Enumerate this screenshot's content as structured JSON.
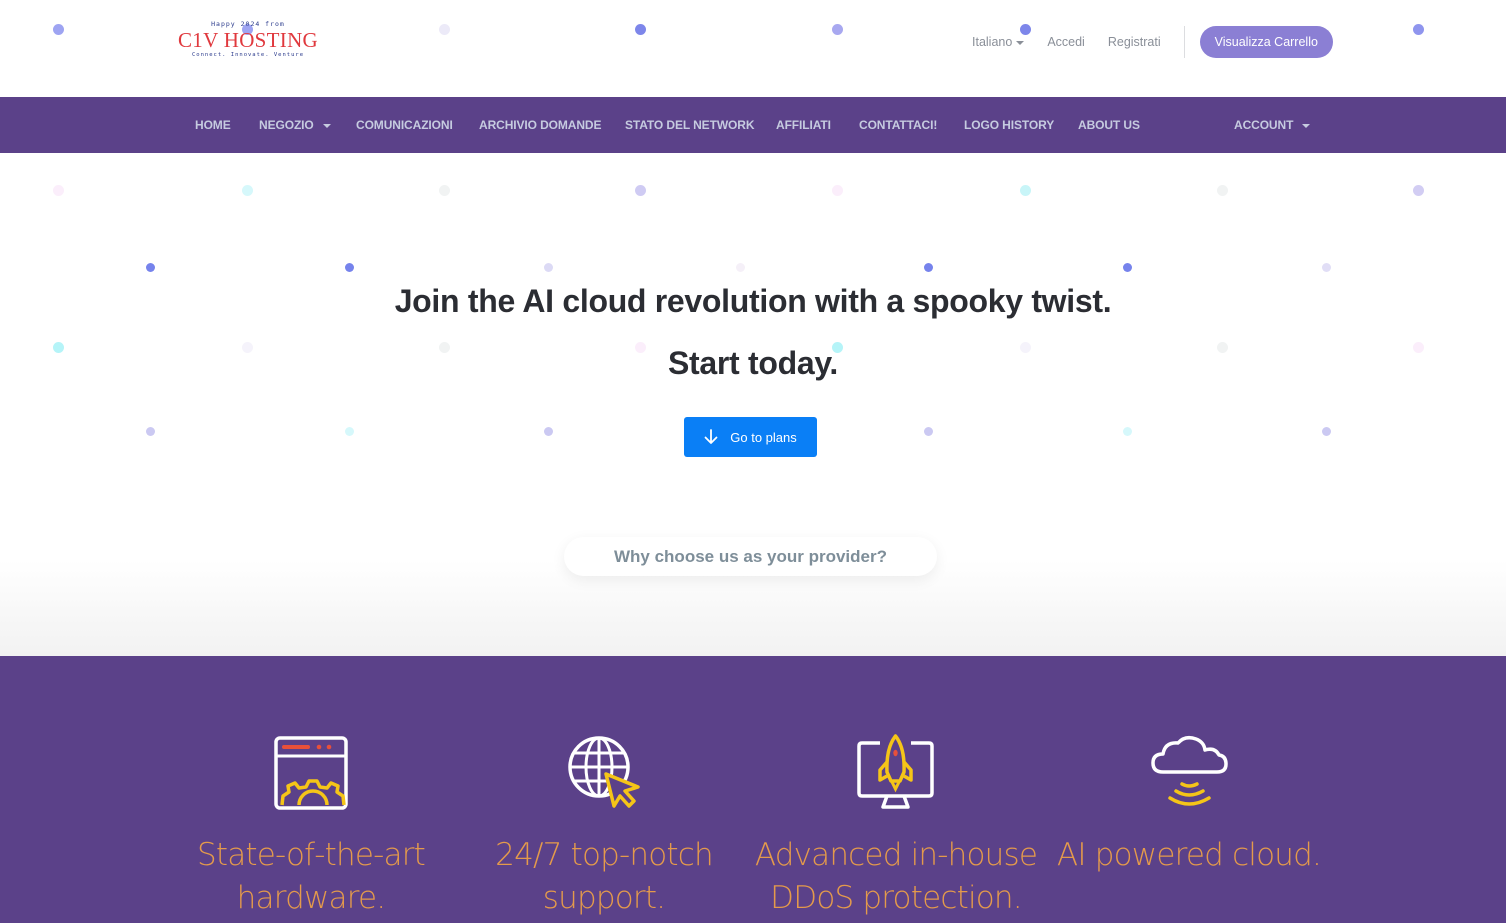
{
  "header": {
    "logo": {
      "tagline_top": "Happy 2024 from",
      "brand": "C1V HOSTING",
      "tagline_bottom": "Connect. Innovate. Venture"
    },
    "language": "Italiano",
    "login": "Accedi",
    "register": "Registrati",
    "cart_button": "Visualizza Carrello"
  },
  "nav": {
    "items": [
      {
        "label": "HOME",
        "dropdown": false
      },
      {
        "label": "NEGOZIO",
        "dropdown": true
      },
      {
        "label": "COMUNICAZIONI",
        "dropdown": false
      },
      {
        "label": "ARCHIVIO DOMANDE",
        "dropdown": false
      },
      {
        "label": "STATO DEL NETWORK",
        "dropdown": false
      },
      {
        "label": "AFFILIATI",
        "dropdown": false
      },
      {
        "label": "CONTATTACI!",
        "dropdown": false
      },
      {
        "label": "LOGO HISTORY",
        "dropdown": false
      },
      {
        "label": "ABOUT US",
        "dropdown": false
      }
    ],
    "account": {
      "label": "ACCOUNT",
      "dropdown": true
    }
  },
  "hero": {
    "title": "Join the AI cloud revolution with a spooky twist.",
    "subtitle": "Start today.",
    "cta": "Go to plans",
    "cta_icon": "arrow-down-icon"
  },
  "why": {
    "heading": "Why choose us as your provider?"
  },
  "features": [
    {
      "icon": "browser-gear-icon",
      "line1": "State-of-the-art",
      "line2": "hardware."
    },
    {
      "icon": "globe-cursor-icon",
      "line1": "24/7 top-notch",
      "line2": "support."
    },
    {
      "icon": "monitor-rocket-icon",
      "line1": "Advanced in-house",
      "line2": "DDoS protection."
    },
    {
      "icon": "cloud-signal-icon",
      "line1": "AI powered cloud.",
      "line2": ""
    }
  ],
  "colors": {
    "brand_purple": "#5b4189",
    "cart_button": "#8b7fd4",
    "cta_blue": "#0a7ff6",
    "feature_text": "#e49a4b",
    "icon_yellow": "#f5c518",
    "logo_red": "#e0393e"
  }
}
